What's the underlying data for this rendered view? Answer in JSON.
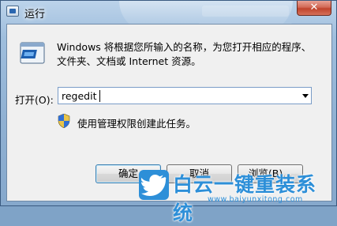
{
  "window": {
    "title": "运行",
    "close_glyph": "✕",
    "icon": "run-app-icon"
  },
  "content": {
    "description": "Windows 将根据您所输入的名称，为您打开相应的程序、\n文件夹、文档或 Internet 资源。",
    "open_label": "打开(O):",
    "open_value": "regedit",
    "admin_note": "使用管理权限创建此任务。"
  },
  "buttons": {
    "ok": "确定",
    "cancel": "取消",
    "browse": "浏览(B)..."
  },
  "watermark": {
    "text": "白云一键重装系统",
    "url": "www.baiyunxitong.com",
    "color": "#2d8fd8"
  }
}
